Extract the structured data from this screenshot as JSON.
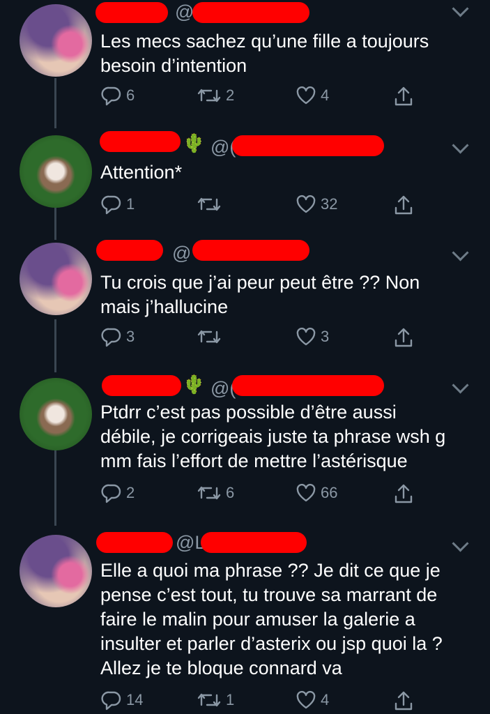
{
  "tweets": [
    {
      "handle_prefix": "@",
      "text_lines": [
        "Les mecs sachez qu’une fille a toujours",
        "besoin d’intention"
      ],
      "reply_count": "6",
      "retweet_count": "2",
      "like_count": "4"
    },
    {
      "handle_prefix": "@(",
      "text_lines": [
        "Attention*"
      ],
      "reply_count": "1",
      "retweet_count": "",
      "like_count": "32"
    },
    {
      "handle_prefix": "@",
      "text_lines": [
        "Tu crois que j’ai peur peut être ?? Non",
        "mais j’hallucine"
      ],
      "reply_count": "3",
      "retweet_count": "",
      "like_count": "3"
    },
    {
      "handle_prefix": "@(",
      "text_lines": [
        "Ptdrr c’est pas possible d’être aussi",
        "débile, je corrigeais juste ta phrase wsh g",
        "mm fais l’effort de mettre l’astérisque"
      ],
      "reply_count": "2",
      "retweet_count": "6",
      "like_count": "66"
    },
    {
      "handle_prefix": "@L",
      "text_lines": [
        "Elle a quoi ma phrase ?? Je dit ce que je",
        "pense c’est tout, tu trouve sa marrant de",
        "faire le malin pour amuser la galerie a",
        "insulter et parler d’asterix ou jsp quoi la ?",
        "Allez je te bloque connard va"
      ],
      "reply_count": "14",
      "retweet_count": "1",
      "like_count": "4"
    }
  ],
  "emoji": {
    "cactus": "🌵"
  },
  "colors": {
    "background": "#0d141d",
    "text": "#ffffff",
    "muted": "#8b98a5",
    "redaction": "#ff0000"
  }
}
